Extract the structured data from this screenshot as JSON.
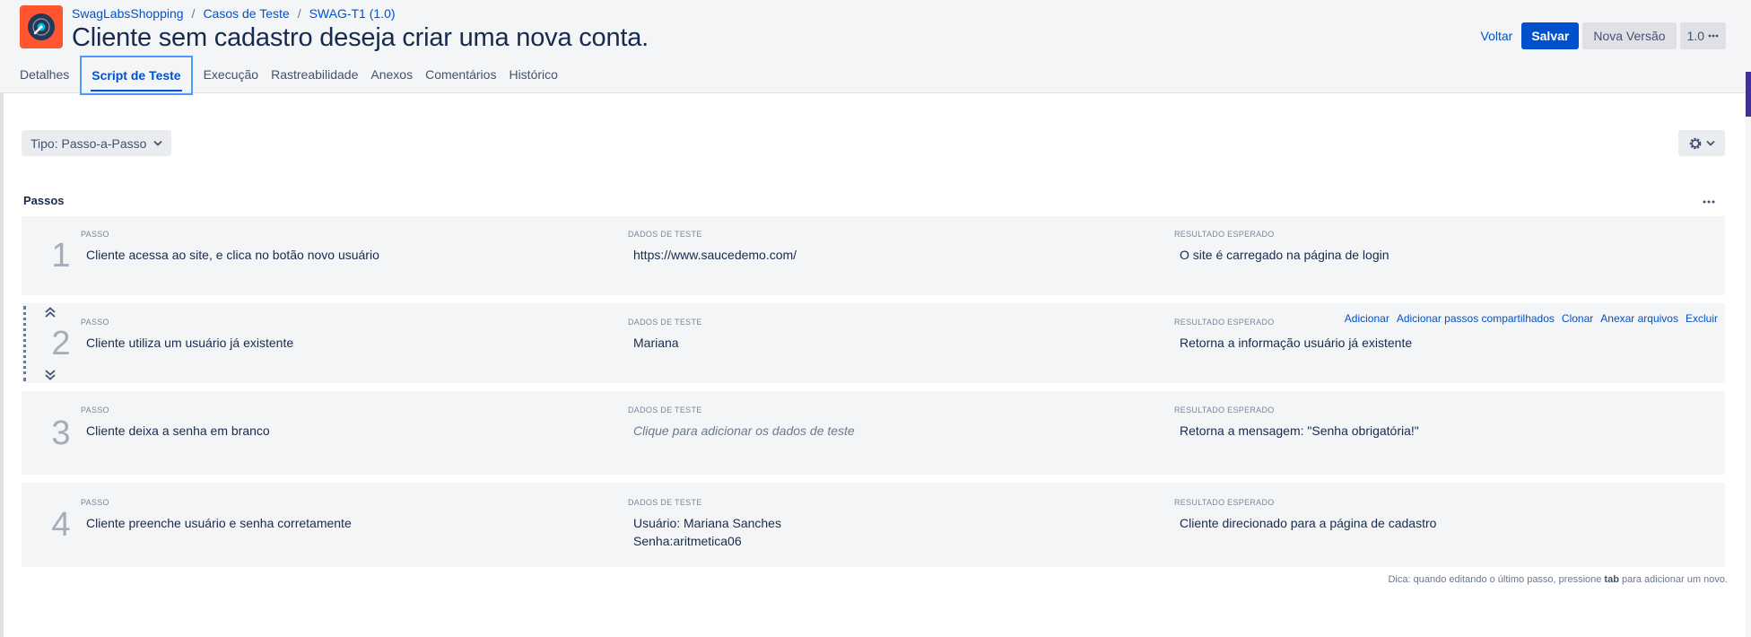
{
  "header": {
    "breadcrumb": {
      "project": "SwagLabsShopping",
      "section": "Casos de Teste",
      "item": "SWAG-T1 (1.0)"
    },
    "title": "Cliente sem cadastro deseja criar uma nova conta.",
    "actions": {
      "back": "Voltar",
      "save": "Salvar",
      "new_version": "Nova Versão",
      "version": "1.0"
    },
    "icons": {
      "logo": "record-disc-logo",
      "more": "more-dots-icon"
    }
  },
  "tabs": [
    {
      "label": "Detalhes"
    },
    {
      "label": "Script de Teste",
      "active": true
    },
    {
      "label": "Execução"
    },
    {
      "label": "Rastreabilidade"
    },
    {
      "label": "Anexos"
    },
    {
      "label": "Comentários"
    },
    {
      "label": "Histórico"
    }
  ],
  "toolbar": {
    "type_select": "Tipo: Passo-a-Passo",
    "settings_icon": "gear-icon"
  },
  "steps_section": {
    "title": "Passos",
    "columns": {
      "step": "PASSO",
      "data": "DADOS DE TESTE",
      "result": "RESULTADO ESPERADO"
    },
    "row_actions": [
      "Adicionar",
      "Adicionar passos compartilhados",
      "Clonar",
      "Anexar arquivos",
      "Excluir"
    ],
    "steps": [
      {
        "number": "1",
        "step": "Cliente acessa ao site, e clica no botão novo usuário",
        "data": "https://www.saucedemo.com/",
        "result": "O site é carregado na página de login"
      },
      {
        "number": "2",
        "step": "Cliente utiliza um usuário já existente",
        "data": "Mariana",
        "result": "Retorna a informação usuário já existente"
      },
      {
        "number": "3",
        "step": "Cliente deixa a senha em branco",
        "data": "Clique para adicionar os dados de teste",
        "result": "Retorna a mensagem: \"Senha obrigatória!\""
      },
      {
        "number": "4",
        "step": "Cliente preenche usuário e senha corretamente",
        "data": "Usuário: Mariana Sanches\nSenha:aritmetica06",
        "result": "Cliente direcionado para a página de cadastro"
      }
    ]
  },
  "hint": {
    "before": "Dica: quando editando o último passo, pressione ",
    "key": "tab",
    "after": " para adicionar um novo."
  }
}
